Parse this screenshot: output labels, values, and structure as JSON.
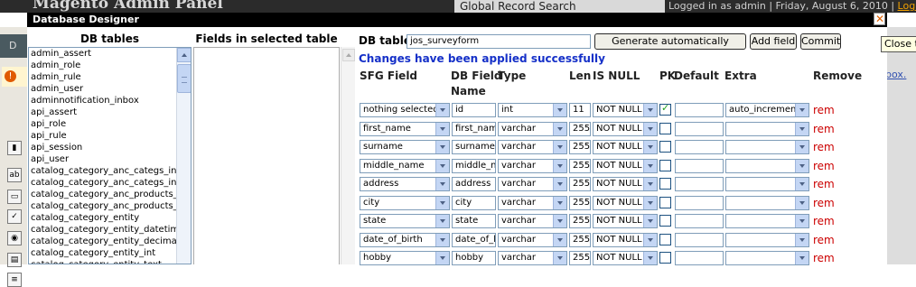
{
  "background": {
    "logo": "Magento Admin Panel",
    "global_search": "Global Record Search",
    "user_info": "Logged in as admin  |  Friday, August 6, 2010  |",
    "logout": "Log Out",
    "nav_fragment": "D",
    "warning_fragment": "L",
    "right_fragment": "box."
  },
  "dialog": {
    "title": "Database Designer",
    "close_tooltip": "Close th"
  },
  "tables_pane": {
    "header": "DB tables",
    "items": [
      "admin_assert",
      "admin_role",
      "admin_rule",
      "admin_user",
      "adminnotification_inbox",
      "api_assert",
      "api_role",
      "api_rule",
      "api_session",
      "api_user",
      "catalog_category_anc_categs_ind",
      "catalog_category_anc_categs_ind",
      "catalog_category_anc_products_in",
      "catalog_category_anc_products_in",
      "catalog_category_entity",
      "catalog_category_entity_datetime",
      "catalog_category_entity_decimal",
      "catalog_category_entity_int",
      "catalog_category_entity_text"
    ]
  },
  "fields_pane": {
    "header": "Fields in selected table"
  },
  "designer": {
    "db_table_label": "DB table:",
    "db_table_value": "jos_surveyform",
    "generate_button": "Generate automatically",
    "add_field_button": "Add field",
    "commit_button": "Commit",
    "status": "Changes have been applied successfully",
    "columns": {
      "sfg_field": "SFG Field",
      "db_field_line1": "DB Field",
      "db_field_line2": "Name",
      "type": "Type",
      "len": "Len",
      "is_null": "IS NULL",
      "pk": "PK",
      "default": "Default",
      "extra": "Extra",
      "remove": "Remove"
    },
    "rows": [
      {
        "sfg": "nothing selected",
        "db": "id",
        "type": "int",
        "len": "11",
        "null": "NOT NULL",
        "pk": true,
        "default": "",
        "extra": "auto_increment",
        "rem": "rem"
      },
      {
        "sfg": "first_name",
        "db": "first_name",
        "type": "varchar",
        "len": "255",
        "null": "NOT NULL",
        "pk": false,
        "default": "",
        "extra": "",
        "rem": "rem"
      },
      {
        "sfg": "surname",
        "db": "surname",
        "type": "varchar",
        "len": "255",
        "null": "NOT NULL",
        "pk": false,
        "default": "",
        "extra": "",
        "rem": "rem"
      },
      {
        "sfg": "middle_name",
        "db": "middle_name",
        "type": "varchar",
        "len": "255",
        "null": "NOT NULL",
        "pk": false,
        "default": "",
        "extra": "",
        "rem": "rem"
      },
      {
        "sfg": "address",
        "db": "address",
        "type": "varchar",
        "len": "255",
        "null": "NOT NULL",
        "pk": false,
        "default": "",
        "extra": "",
        "rem": "rem"
      },
      {
        "sfg": "city",
        "db": "city",
        "type": "varchar",
        "len": "255",
        "null": "NOT NULL",
        "pk": false,
        "default": "",
        "extra": "",
        "rem": "rem"
      },
      {
        "sfg": "state",
        "db": "state",
        "type": "varchar",
        "len": "255",
        "null": "NOT NULL",
        "pk": false,
        "default": "",
        "extra": "",
        "rem": "rem"
      },
      {
        "sfg": "date_of_birth",
        "db": "date_of_birth",
        "type": "varchar",
        "len": "255",
        "null": "NOT NULL",
        "pk": false,
        "default": "",
        "extra": "",
        "rem": "rem"
      },
      {
        "sfg": "hobby",
        "db": "hobby",
        "type": "varchar",
        "len": "255",
        "null": "NOT NULL",
        "pk": false,
        "default": "",
        "extra": "",
        "rem": "rem"
      }
    ]
  }
}
